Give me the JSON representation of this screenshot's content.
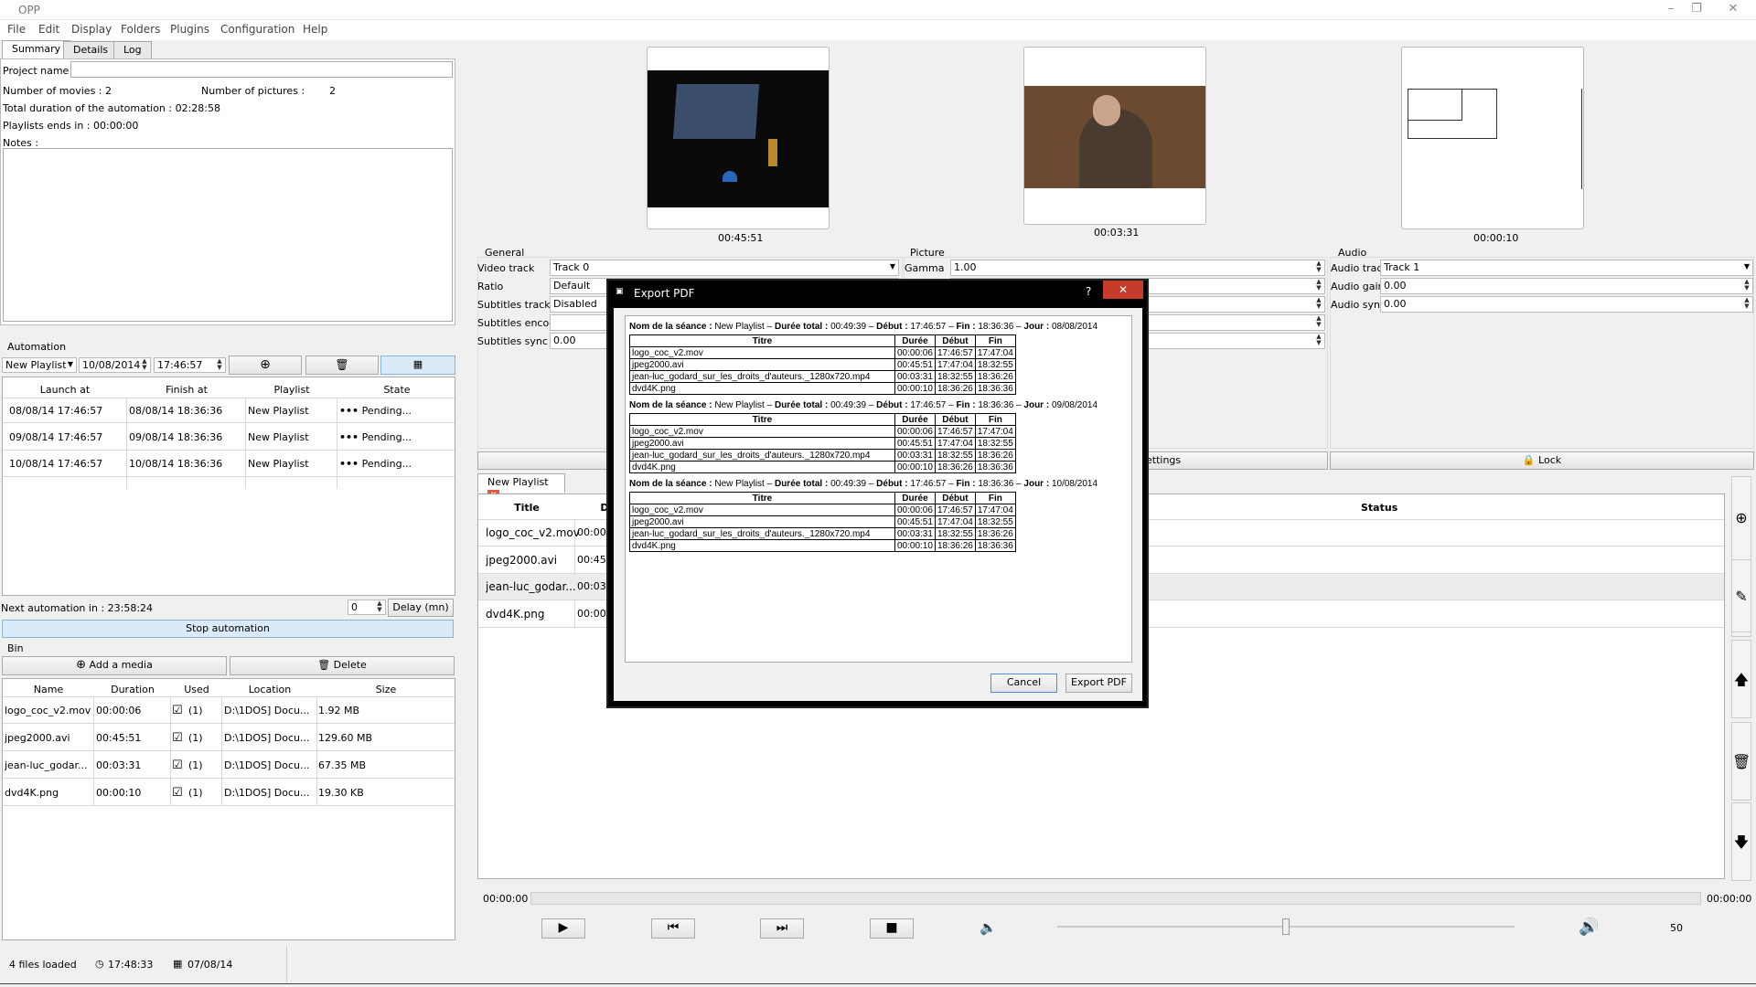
{
  "app": {
    "title": "OPP",
    "min": "–",
    "max": "❐",
    "close": "✕"
  },
  "menu": [
    "File",
    "Edit",
    "Display",
    "Folders",
    "Plugins",
    "Configuration",
    "Help"
  ],
  "tabs": [
    "Summary",
    "Details",
    "Log"
  ],
  "summary": {
    "project_label": "Project name :",
    "project_value": "",
    "movies_label": "Number of movies : 2",
    "pictures_label": "Number of pictures :",
    "pictures_value": "2",
    "total_duration": "Total duration of the automation :  02:28:58",
    "playlist_ends": "Playlists ends in : 00:00:00",
    "notes_label": "Notes :"
  },
  "automation": {
    "label": "Automation",
    "playlist": "New Playlist",
    "date": "10/08/2014",
    "time": "17:46:57",
    "columns": [
      "Launch at",
      "Finish at",
      "Playlist",
      "State"
    ],
    "rows": [
      {
        "launch": "08/08/14 17:46:57",
        "finish": "08/08/14 18:36:36",
        "playlist": "New Playlist",
        "state": "Pending..."
      },
      {
        "launch": "09/08/14 17:46:57",
        "finish": "09/08/14 18:36:36",
        "playlist": "New Playlist",
        "state": "Pending..."
      },
      {
        "launch": "10/08/14 17:46:57",
        "finish": "10/08/14 18:36:36",
        "playlist": "New Playlist",
        "state": "Pending..."
      }
    ],
    "next": "Next automation in : 23:58:24",
    "delay_value": "0",
    "delay_label": "Delay (mn)",
    "stop": "Stop automation"
  },
  "bin": {
    "label": "Bin",
    "add": "Add a media",
    "delete": "Delete",
    "columns": [
      "Name",
      "Duration",
      "Used",
      "Location",
      "Size"
    ],
    "rows": [
      {
        "name": "logo_coc_v2.mov",
        "duration": "00:00:06",
        "used": "(1)",
        "location": "D:\\1DOS] Docu...",
        "size": "1.92 MB"
      },
      {
        "name": "jpeg2000.avi",
        "duration": "00:45:51",
        "used": "(1)",
        "location": "D:\\1DOS] Docu...",
        "size": "129.60 MB"
      },
      {
        "name": "jean-luc_godar...",
        "duration": "00:03:31",
        "used": "(1)",
        "location": "D:\\1DOS] Docu...",
        "size": "67.35 MB"
      },
      {
        "name": "dvd4K.png",
        "duration": "00:00:10",
        "used": "(1)",
        "location": "D:\\1DOS] Docu...",
        "size": "19.30 KB"
      }
    ]
  },
  "status": {
    "files": "4 files loaded",
    "time": "17:48:33",
    "date": "07/08/14"
  },
  "previews": [
    "00:45:51",
    "00:03:31",
    "00:00:10"
  ],
  "general": {
    "label": "General",
    "video_track_label": "Video track",
    "video_track": "Track 0",
    "ratio_label": "Ratio",
    "ratio": "Default",
    "subs_label": "Subtitles track",
    "subs": "Disabled",
    "subs_enc_label": "Subtitles encode",
    "subs_sync_label": "Subtitles sync",
    "subs_sync": "0.00"
  },
  "picture": {
    "label": "Picture",
    "gamma_label": "Gamma",
    "gamma": "1.00"
  },
  "audio": {
    "label": "Audio",
    "track_label": "Audio track",
    "track": "Track 1",
    "gain_label": "Audio gain",
    "gain": "0.00",
    "sync_label": "Audio sync",
    "sync": "0.00"
  },
  "settings_btn": "ettings",
  "lock_btn": "Lock",
  "playlist": {
    "tab": "New Playlist",
    "title_col": "Title",
    "d_col": "D",
    "status_col": "Status",
    "rows": [
      {
        "title": "logo_coc_v2.mov",
        "d": "00:00:"
      },
      {
        "title": "jpeg2000.avi",
        "d": "00:45:"
      },
      {
        "title": "jean-luc_godar...",
        "d": "00:03:"
      },
      {
        "title": "dvd4K.png",
        "d": "00:00:"
      }
    ]
  },
  "player": {
    "start": "00:00:00",
    "end": "00:00:00",
    "volume": "50",
    "volume_level": 0.5
  },
  "dialog": {
    "title": "Export PDF",
    "help": "?",
    "cancel": "Cancel",
    "export": "Export PDF",
    "cols": [
      "Titre",
      "Durée",
      "Début",
      "Fin"
    ],
    "sessions": [
      {
        "name_label": "Nom de la séance :",
        "name": "New Playlist",
        "dur_label": "Durée total :",
        "dur": "00:49:39",
        "deb_label": "Début :",
        "deb": "17:46:57",
        "fin_label": "Fin :",
        "fin": "18:36:36",
        "jour_label": "Jour :",
        "jour": "08/08/2014"
      },
      {
        "name_label": "Nom de la séance :",
        "name": "New Playlist",
        "dur_label": "Durée total :",
        "dur": "00:49:39",
        "deb_label": "Début :",
        "deb": "17:46:57",
        "fin_label": "Fin :",
        "fin": "18:36:36",
        "jour_label": "Jour :",
        "jour": "09/08/2014"
      },
      {
        "name_label": "Nom de la séance :",
        "name": "New Playlist",
        "dur_label": "Durée total :",
        "dur": "00:49:39",
        "deb_label": "Début :",
        "deb": "17:46:57",
        "fin_label": "Fin :",
        "fin": "18:36:36",
        "jour_label": "Jour :",
        "jour": "10/08/2014"
      }
    ],
    "rows": [
      {
        "titre": "logo_coc_v2.mov",
        "duree": "00:00:06",
        "debut": "17:46:57",
        "fin": "17:47:04"
      },
      {
        "titre": "jpeg2000.avi",
        "duree": "00:45:51",
        "debut": "17:47:04",
        "fin": "18:32:55"
      },
      {
        "titre": "jean-luc_godard_sur_les_droits_d'auteurs._1280x720.mp4",
        "duree": "00:03:31",
        "debut": "18:32:55",
        "fin": "18:36:26"
      },
      {
        "titre": "dvd4K.png",
        "duree": "00:00:10",
        "debut": "18:36:26",
        "fin": "18:36:36"
      }
    ]
  }
}
